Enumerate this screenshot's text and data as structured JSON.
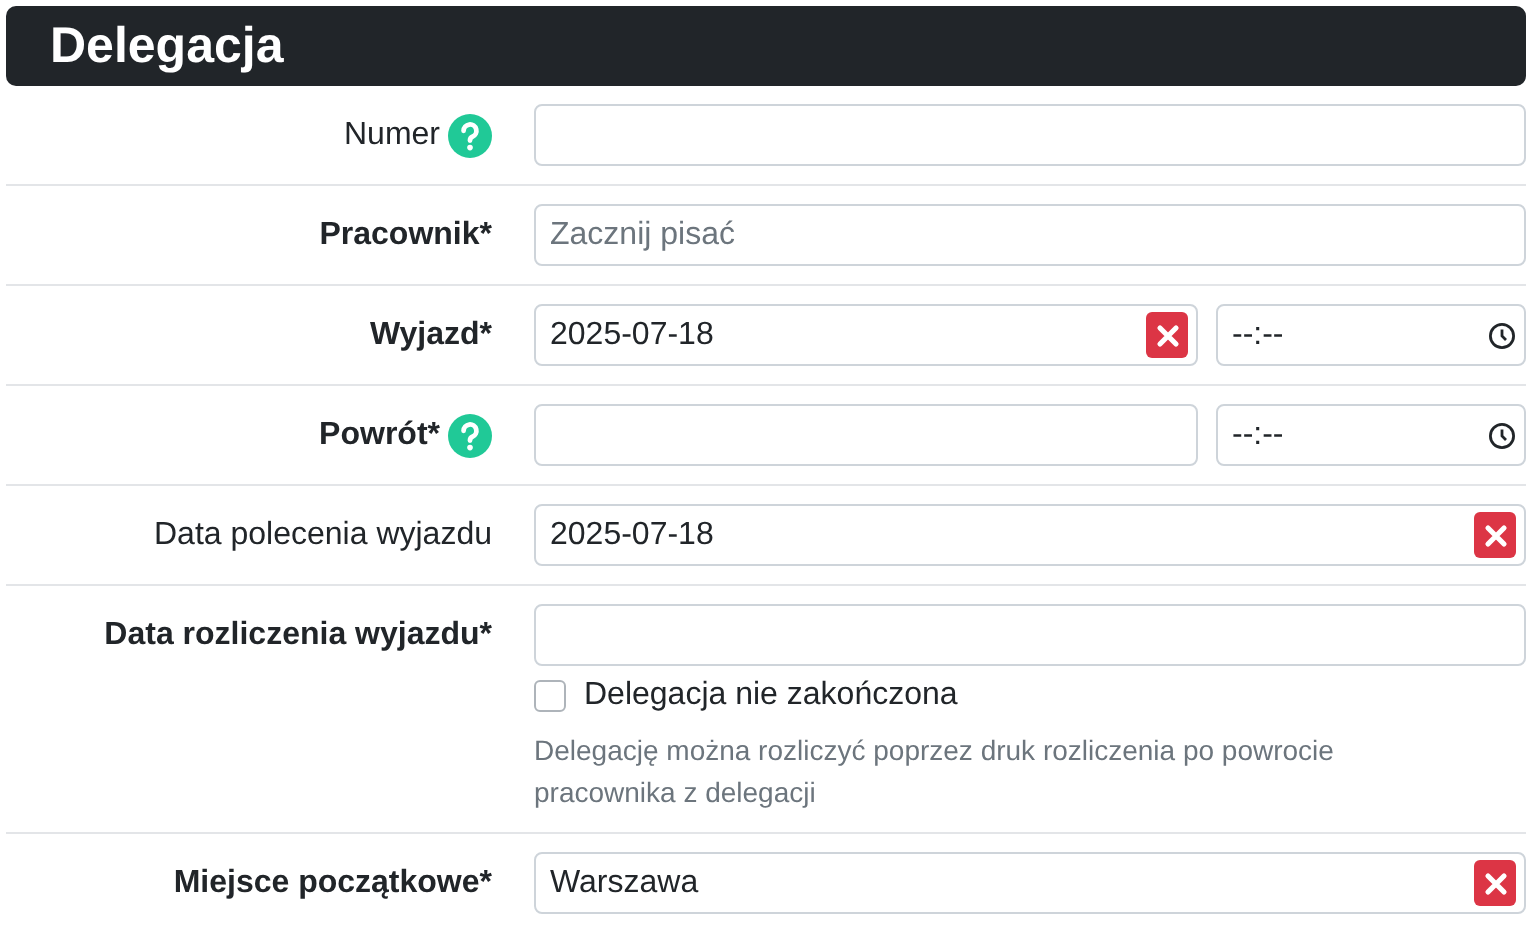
{
  "header": {
    "title": "Delegacja"
  },
  "rows": [
    {
      "label": "Numer",
      "bold": false,
      "help": true,
      "fields": [
        {
          "kind": "text",
          "clearable": false
        }
      ]
    },
    {
      "label": "Pracownik*",
      "bold": true,
      "help": false,
      "fields": [
        {
          "kind": "text",
          "placeholder": "Zacznij pisać",
          "clearable": false
        }
      ]
    },
    {
      "label": "Wyjazd*",
      "bold": true,
      "help": false,
      "fields": [
        {
          "kind": "date",
          "value": "2025-07-18",
          "clearable": true
        },
        {
          "kind": "time",
          "value": "--:--"
        }
      ]
    },
    {
      "label": "Powrót*",
      "bold": true,
      "help": true,
      "fields": [
        {
          "kind": "date",
          "clearable": false
        },
        {
          "kind": "time",
          "value": "--:--"
        }
      ]
    },
    {
      "label": "Data polecenia wyjazdu",
      "bold": false,
      "help": false,
      "fields": [
        {
          "kind": "text",
          "value": "2025-07-18",
          "clearable": true
        }
      ]
    },
    {
      "label": "Data rozliczenia wyjazdu*",
      "bold": true,
      "help": false,
      "fields": [
        {
          "kind": "text",
          "clearable": false
        }
      ],
      "checkbox": {
        "label": "Delegacja nie zakończona",
        "checked": false
      },
      "hint": "Delegację można rozliczyć poprzez druk rozliczenia po powrocie pracownika z delegacji"
    },
    {
      "label": "Miejsce początkowe*",
      "bold": true,
      "help": false,
      "fields": [
        {
          "kind": "text",
          "value": "Warszawa",
          "clearable": true
        }
      ]
    }
  ]
}
